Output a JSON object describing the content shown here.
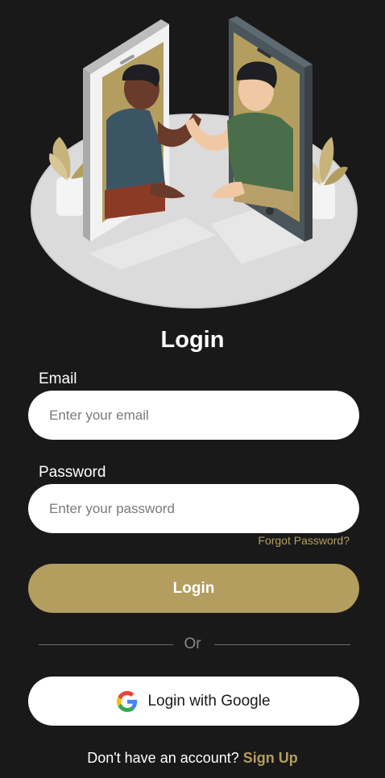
{
  "page": {
    "title": "Login"
  },
  "form": {
    "email_label": "Email",
    "email_placeholder": "Enter your email",
    "password_label": "Password",
    "password_placeholder": "Enter your password",
    "forgot_label": "Forgot Password?",
    "login_label": "Login"
  },
  "divider": {
    "text": "Or"
  },
  "google": {
    "label": "Login with Google",
    "icon": "google-icon"
  },
  "footer": {
    "prompt": "Don't have an account?",
    "signup_label": "Sign Up"
  },
  "colors": {
    "background": "#1a191a",
    "accent": "#b39e5f",
    "field": "#ffffff"
  }
}
